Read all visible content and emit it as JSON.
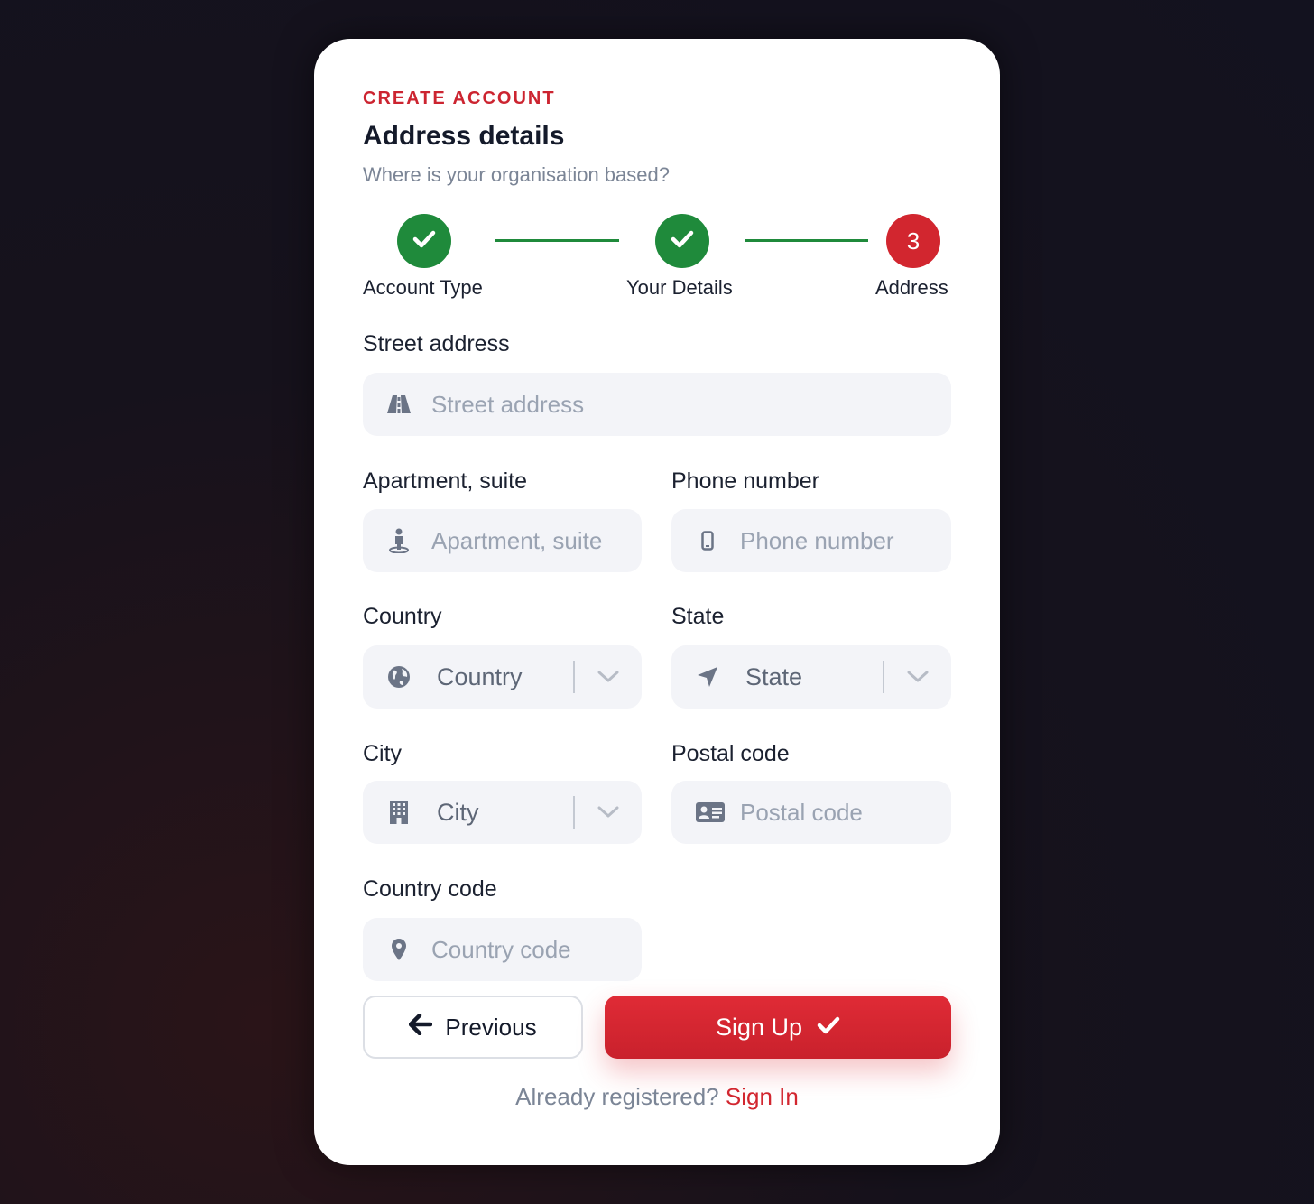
{
  "header": {
    "eyebrow": "CREATE ACCOUNT",
    "title": "Address details",
    "subtitle": "Where is your organisation based?"
  },
  "stepper": {
    "steps": [
      {
        "label": "Account Type",
        "status": "complete",
        "icon": "check-icon"
      },
      {
        "label": "Your Details",
        "status": "complete",
        "icon": "check-icon"
      },
      {
        "label": "Address",
        "status": "current",
        "number": "3"
      }
    ],
    "complete_color": "#1f8a3b",
    "current_color": "#d2262f"
  },
  "form": {
    "street": {
      "label": "Street address",
      "placeholder": "Street address",
      "icon": "road-icon"
    },
    "apartment": {
      "label": "Apartment, suite",
      "placeholder": "Apartment, suite",
      "icon": "person-pin-icon"
    },
    "phone": {
      "label": "Phone number",
      "placeholder": "Phone number",
      "icon": "mobile-phone-icon"
    },
    "country": {
      "label": "Country",
      "value": "Country",
      "icon": "globe-icon"
    },
    "state": {
      "label": "State",
      "value": "State",
      "icon": "location-arrow-icon"
    },
    "city": {
      "label": "City",
      "value": "City",
      "icon": "building-icon"
    },
    "postal": {
      "label": "Postal code",
      "placeholder": "Postal code",
      "icon": "address-card-icon"
    },
    "country_code": {
      "label": "Country code",
      "placeholder": "Country code",
      "icon": "map-pin-icon"
    }
  },
  "actions": {
    "previous_label": "Previous",
    "signup_label": "Sign Up",
    "accent_color": "#d2262f"
  },
  "footer": {
    "prompt": "Already registered?",
    "link": "Sign In"
  }
}
